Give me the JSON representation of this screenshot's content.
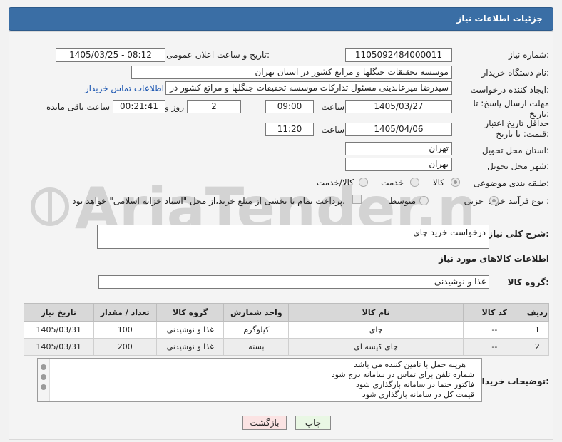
{
  "header": {
    "title": "جزئیات اطلاعات نیاز"
  },
  "form": {
    "need_number_label": "شماره نیاز:",
    "need_number": "1105092484000011",
    "announce_label": "تاریخ و ساعت اعلان عمومی:",
    "announce_value": "1405/03/25 - 08:12",
    "buyer_org_label": "نام دستگاه خریدار:",
    "buyer_org": "موسسه تحقیقات جنگلها و مراتع کشور در استان تهران",
    "requester_label": "ایجاد کننده درخواست:",
    "requester": "سیدرضا میرعابدینی مسئول تدارکات موسسه تحقیقات جنگلها و مراتع کشور در",
    "buyer_contact_link": "اطلاعات تماس خریدار",
    "reply_deadline_label": "مهلت ارسال پاسخ: تا تاریخ:",
    "reply_date": "1405/03/27",
    "time_label": "ساعت",
    "reply_time": "09:00",
    "days_value": "2",
    "days_label": "روز و",
    "remaining_value": "00:21:41",
    "remaining_label": "ساعت باقی مانده",
    "price_validity_label": "حداقل تاریخ اعتبار قیمت: تا تاریخ:",
    "price_date": "1405/04/06",
    "price_time": "11:20",
    "delivery_province_label": "استان محل تحویل:",
    "delivery_province": "تهران",
    "delivery_city_label": "شهر محل تحویل:",
    "delivery_city": "تهران",
    "category_label": "طبقه بندی موضوعی:",
    "category_options": [
      "کالا",
      "خدمت",
      "کالا/خدمت"
    ],
    "process_label": "نوع فرآیند خرید :",
    "process_options": [
      "جزیی",
      "متوسط"
    ],
    "payment_note": "پرداخت تمام یا بخشی از مبلغ خرید،از محل \"اسناد خزانه اسلامی\" خواهد بود."
  },
  "description": {
    "label": "شرح کلی نیاز:",
    "value": "درخواست خرید چای"
  },
  "goods": {
    "section_title": "اطلاعات کالاهای مورد نیاز",
    "group_label": "گروه کالا:",
    "group_value": "غذا و نوشیدنی",
    "columns": [
      "ردیف",
      "کد کالا",
      "نام کالا",
      "واحد شمارش",
      "گروه کالا",
      "تعداد / مقدار",
      "تاریخ نیاز"
    ],
    "rows": [
      [
        "1",
        "--",
        "چای",
        "کیلوگرم",
        "غذا و نوشیدنی",
        "100",
        "1405/03/31"
      ],
      [
        "2",
        "--",
        "چای کیسه ای",
        "بسته",
        "غذا و نوشیدنی",
        "200",
        "1405/03/31"
      ]
    ]
  },
  "buyer_notes": {
    "label": "توضیحات خریدار:",
    "lines": [
      "هزینه حمل با تامین کننده می باشد",
      "شماره تلفن برای تماس در سامانه درج شود",
      "فاکتور حتما در سامانه بارگذاری شود",
      "قیمت کل در سامانه بارگذاری شود"
    ]
  },
  "buttons": {
    "print": "چاپ",
    "back": "بازگشت"
  },
  "watermark": {
    "text": "AriaTender.neT"
  },
  "colors": {
    "header_bg": "#3a6ea5",
    "link": "#1a55b0",
    "print_btn": "#e9f7e4",
    "back_btn": "#fbe3e3"
  }
}
